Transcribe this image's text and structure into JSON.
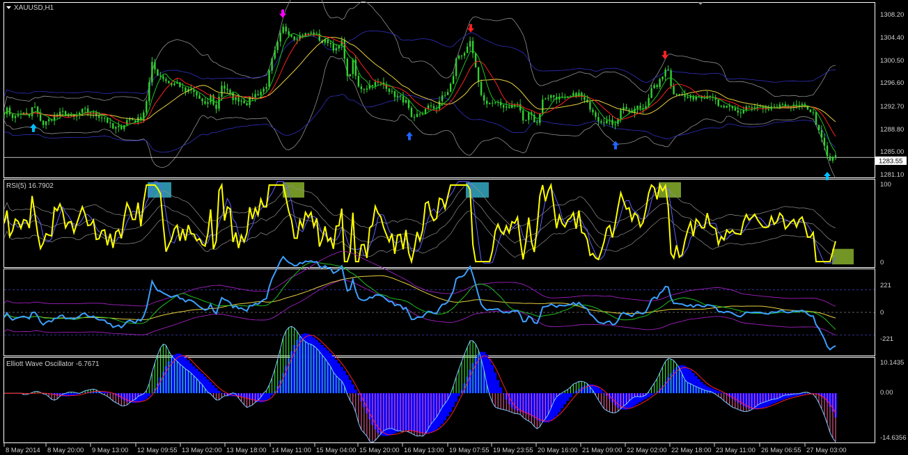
{
  "chart_data": [
    {
      "type": "candlestick",
      "title": "XAUUSD,H1",
      "ylim": [
        1280.0,
        1311.0
      ],
      "y_ticks": [
        "1308.20",
        "1304.40",
        "1300.50",
        "1296.60",
        "1292.70",
        "1288.80",
        "1285.00",
        "1281.10"
      ],
      "current_price": "1283.55",
      "close_path": [
        [
          0,
          1291.2
        ],
        [
          10,
          1292.0
        ],
        [
          20,
          1290.5
        ],
        [
          30,
          1291.5
        ],
        [
          42,
          1290.8
        ],
        [
          48,
          1293.0
        ],
        [
          55,
          1291.0
        ],
        [
          62,
          1289.4
        ],
        [
          75,
          1290.6
        ],
        [
          90,
          1291.5
        ],
        [
          105,
          1290.5
        ],
        [
          120,
          1292.0
        ],
        [
          135,
          1291.2
        ],
        [
          150,
          1290.6
        ],
        [
          162,
          1288.6
        ],
        [
          175,
          1289.0
        ],
        [
          185,
          1290.5
        ],
        [
          195,
          1290.0
        ],
        [
          205,
          1291.0
        ],
        [
          212,
          1294.5
        ],
        [
          218,
          1300.2
        ],
        [
          225,
          1298.5
        ],
        [
          235,
          1297.6
        ],
        [
          245,
          1296.5
        ],
        [
          255,
          1296.8
        ],
        [
          265,
          1295.2
        ],
        [
          275,
          1295.5
        ],
        [
          285,
          1294.2
        ],
        [
          295,
          1292.6
        ],
        [
          303,
          1294.5
        ],
        [
          310,
          1291.8
        ],
        [
          318,
          1296.5
        ],
        [
          325,
          1295.5
        ],
        [
          335,
          1294.0
        ],
        [
          345,
          1293.8
        ],
        [
          355,
          1293.2
        ],
        [
          362,
          1294.4
        ],
        [
          372,
          1295.0
        ],
        [
          382,
          1296.0
        ],
        [
          390,
          1300.5
        ],
        [
          398,
          1303.5
        ],
        [
          406,
          1306.6
        ],
        [
          414,
          1305.8
        ],
        [
          422,
          1304.8
        ],
        [
          432,
          1305.2
        ],
        [
          442,
          1305.5
        ],
        [
          452,
          1305.6
        ],
        [
          462,
          1304.0
        ],
        [
          472,
          1304.2
        ],
        [
          482,
          1302.4
        ],
        [
          492,
          1304.2
        ],
        [
          500,
          1296.5
        ],
        [
          506,
          1301.0
        ],
        [
          514,
          1296.0
        ],
        [
          524,
          1295.8
        ],
        [
          534,
          1296.6
        ],
        [
          544,
          1296.8
        ],
        [
          554,
          1296.3
        ],
        [
          564,
          1294.8
        ],
        [
          574,
          1294.1
        ],
        [
          584,
          1293.3
        ],
        [
          592,
          1289.8
        ],
        [
          600,
          1291.2
        ],
        [
          608,
          1291.6
        ],
        [
          618,
          1292.8
        ],
        [
          628,
          1292.2
        ],
        [
          636,
          1294.8
        ],
        [
          642,
          1294.7
        ],
        [
          650,
          1297.4
        ],
        [
          656,
          1301.5
        ],
        [
          662,
          1301.8
        ],
        [
          670,
          1302.5
        ],
        [
          676,
          1304.0
        ],
        [
          682,
          1300.0
        ],
        [
          688,
          1296.0
        ],
        [
          695,
          1293.5
        ],
        [
          705,
          1293.2
        ],
        [
          715,
          1293.0
        ],
        [
          725,
          1292.6
        ],
        [
          735,
          1292.7
        ],
        [
          745,
          1293.0
        ],
        [
          752,
          1289.5
        ],
        [
          762,
          1292.0
        ],
        [
          770,
          1289.0
        ],
        [
          780,
          1294.0
        ],
        [
          790,
          1294.5
        ],
        [
          800,
          1294.2
        ],
        [
          812,
          1293.8
        ],
        [
          822,
          1294.5
        ],
        [
          830,
          1295.0
        ],
        [
          840,
          1293.5
        ],
        [
          852,
          1291.8
        ],
        [
          860,
          1290.2
        ],
        [
          872,
          1290.0
        ],
        [
          882,
          1289.5
        ],
        [
          888,
          1290.8
        ],
        [
          895,
          1292.8
        ],
        [
          905,
          1291.2
        ],
        [
          915,
          1292.5
        ],
        [
          925,
          1292.2
        ],
        [
          935,
          1295.5
        ],
        [
          945,
          1296.5
        ],
        [
          952,
          1298.0
        ],
        [
          958,
          1300.5
        ],
        [
          965,
          1295.0
        ],
        [
          972,
          1295.2
        ],
        [
          982,
          1294.3
        ],
        [
          992,
          1294.0
        ],
        [
          1002,
          1294.6
        ],
        [
          1012,
          1294.4
        ],
        [
          1022,
          1294.8
        ],
        [
          1032,
          1292.4
        ],
        [
          1042,
          1292.5
        ],
        [
          1052,
          1292.0
        ],
        [
          1062,
          1291.3
        ],
        [
          1072,
          1292.6
        ],
        [
          1082,
          1292.3
        ],
        [
          1092,
          1292.4
        ],
        [
          1102,
          1291.6
        ],
        [
          1112,
          1292.6
        ],
        [
          1122,
          1292.5
        ],
        [
          1132,
          1292.8
        ],
        [
          1142,
          1292.5
        ],
        [
          1150,
          1292.7
        ],
        [
          1160,
          1292.3
        ],
        [
          1168,
          1291.3
        ],
        [
          1176,
          1288.0
        ],
        [
          1184,
          1285.5
        ],
        [
          1190,
          1282.6
        ],
        [
          1196,
          1283.6
        ]
      ],
      "signal_arrows": [
        {
          "type": "buy",
          "x": 48,
          "color": "#00bfff"
        },
        {
          "type": "sell",
          "x": 406,
          "color": "#ff00ff"
        },
        {
          "type": "buy",
          "x": 588,
          "color": "#1e64ff"
        },
        {
          "type": "sell",
          "x": 676,
          "color": "#ff2020"
        },
        {
          "type": "buy",
          "x": 884,
          "color": "#1e64ff"
        },
        {
          "type": "sell",
          "x": 955,
          "color": "#ff2020"
        },
        {
          "type": "buy",
          "x": 1188,
          "color": "#00bfff"
        }
      ]
    },
    {
      "type": "line",
      "title": "RSI(5) 16.7902",
      "ylim": [
        -5,
        105
      ],
      "y_ticks": [
        "100",
        "0"
      ],
      "highlight_boxes": [
        {
          "x": [
            212,
            246
          ],
          "color": "#30a0b8"
        },
        {
          "x": [
            406,
            437
          ],
          "color": "#7fa52a"
        },
        {
          "x": [
            669,
            702
          ],
          "color": "#30a0b8"
        },
        {
          "x": [
            946,
            978
          ],
          "color": "#7fa52a"
        },
        {
          "x": [
            1195,
            1226
          ],
          "y_top": 18,
          "color": "#7fa52a"
        }
      ]
    },
    {
      "type": "line",
      "title": "",
      "y_ticks": [
        "221",
        "0",
        "-221"
      ],
      "ylim": [
        -420,
        420
      ]
    },
    {
      "type": "bar",
      "title": "Elliott Wave Oscillator -6.7671",
      "ylim": [
        -15.5,
        11.2
      ],
      "y_ticks": [
        "10.1435",
        "0.00",
        "-14.6356"
      ]
    }
  ],
  "x_axis_labels": [
    "8 May 2014",
    "8 May 20:00",
    "9 May 13:00",
    "12 May 09:55",
    "13 May 02:00",
    "13 May 18:00",
    "14 May 11:00",
    "15 May 04:00",
    "15 May 20:00",
    "16 May 13:00",
    "19 May 07:55",
    "19 May 23:55",
    "20 May 16:00",
    "21 May 09:00",
    "22 May 02:00",
    "22 May 18:00",
    "23 May 11:00",
    "26 May 06:55",
    "27 May 03:00"
  ],
  "colors": {
    "background": "#000000",
    "grid": "#ffffff",
    "candle": "#32d132",
    "rsi": "#ffff00",
    "cci": "#3ca0ff",
    "ma_red": "#ff2020",
    "ma_yellow": "#e8d040",
    "ma_green": "#20c020",
    "band_gray": "#909090",
    "band_blue": "#3030c0",
    "ewo_green": "#40ff40",
    "ewo_pink": "#ff6aa0",
    "ewo_blue": "#0000ff"
  }
}
